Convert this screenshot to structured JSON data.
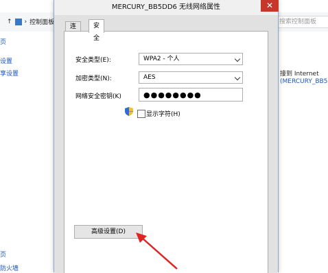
{
  "background_window": {
    "address_crumb": "控制面板",
    "search_placeholder": "搜索控制面板",
    "left_items": [
      "页",
      "设置",
      "享设置"
    ],
    "left_bottom_items": [
      "页",
      "防火墙"
    ],
    "right_connect_text": "接到 Internet",
    "right_network_link": "(MERCURY_BB5DD"
  },
  "dialog": {
    "title": "MERCURY_BB5DD6 无线网络属性",
    "close_glyph": "✕",
    "tabs": [
      {
        "label": "连接",
        "selected": false
      },
      {
        "label": "安全",
        "selected": true
      }
    ],
    "security_type_label": "安全类型(E):",
    "security_type_value": "WPA2 - 个人",
    "encryption_type_label": "加密类型(N):",
    "encryption_type_value": "AES",
    "network_key_label": "网络安全密钥(K)",
    "network_key_value": "●●●●●●●●",
    "show_chars_label": "显示字符(H)",
    "show_chars_checked": false,
    "advanced_button_label": "高级设置(D)"
  },
  "colors": {
    "close_button": "#c7362b",
    "link": "#1a55b3",
    "annotation_arrow": "#e02424"
  }
}
